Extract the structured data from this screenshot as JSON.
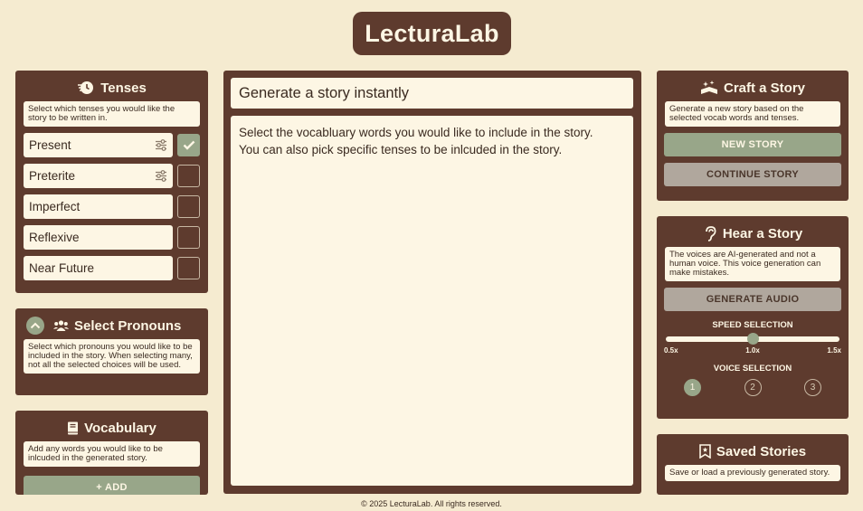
{
  "app": {
    "logo": "LecturaLab"
  },
  "tenses": {
    "title": "Tenses",
    "description": "Select which tenses you would like the story to be written in.",
    "items": [
      {
        "label": "Present",
        "has_settings": true,
        "checked": true
      },
      {
        "label": "Preterite",
        "has_settings": true,
        "checked": false
      },
      {
        "label": "Imperfect",
        "has_settings": false,
        "checked": false
      },
      {
        "label": "Reflexive",
        "has_settings": false,
        "checked": false
      },
      {
        "label": "Near Future",
        "has_settings": false,
        "checked": false
      }
    ]
  },
  "pronouns": {
    "title": "Select Pronouns",
    "description": "Select which pronouns you would like to be included in the story. When selecting many, not all the selected choices will be used."
  },
  "vocabulary": {
    "title": "Vocabulary",
    "description": "Add any words you would like to be inlcuded in the generated story.",
    "add_label": "+ ADD"
  },
  "main": {
    "title": "Generate a story instantly",
    "body_line1": "Select the vocabluary words you would like to include in the story.",
    "body_line2": "You can also pick specific tenses to be inlcuded in the story."
  },
  "craft": {
    "title": "Craft a Story",
    "description": "Generate a new story based on the selected vocab words and tenses.",
    "new_story_label": "NEW STORY",
    "continue_story_label": "CONTINUE STORY"
  },
  "hear": {
    "title": "Hear a Story",
    "description": "The voices are AI-generated and not a human voice. This voice generation can make mistakes.",
    "generate_audio_label": "GENERATE AUDIO",
    "speed_label": "SPEED SELECTION",
    "speed_min": "0.5x",
    "speed_mid": "1.0x",
    "speed_max": "1.5x",
    "speed_value_fraction": 0.5,
    "voice_label": "VOICE SELECTION",
    "voices": [
      "1",
      "2",
      "3"
    ],
    "selected_voice": "1"
  },
  "saved": {
    "title": "Saved Stories",
    "description": "Save or load a previously generated story."
  },
  "footer": {
    "text": "© 2025 LecturaLab. All rights reserved."
  },
  "colors": {
    "background": "#f5ebd0",
    "panel": "#5e3b2e",
    "card": "#fdf6e4",
    "accent_green": "#98a689",
    "button_grey": "#b0a79d"
  }
}
